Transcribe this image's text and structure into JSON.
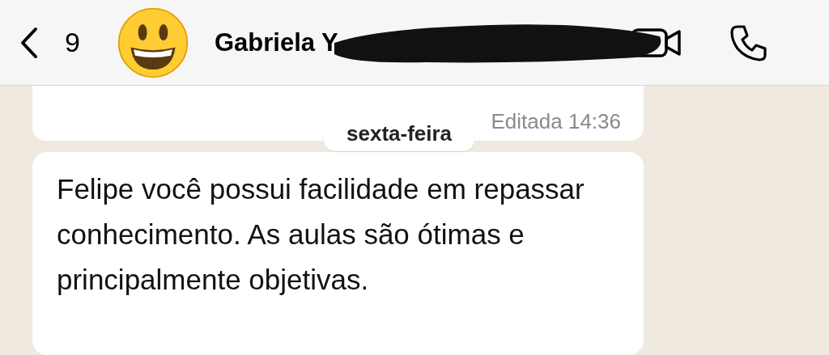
{
  "header": {
    "back_count": "9",
    "contact_name": "Gabriela Y"
  },
  "messages": [
    {
      "kind": "edited_footer",
      "status": "Editada",
      "time": "14:36"
    },
    {
      "kind": "date_separator",
      "text": "sexta-feira"
    },
    {
      "kind": "text",
      "text": "Felipe você possui facilidade em repassar conhecimento. As aulas são ótimas e principalmente objetivas."
    }
  ]
}
